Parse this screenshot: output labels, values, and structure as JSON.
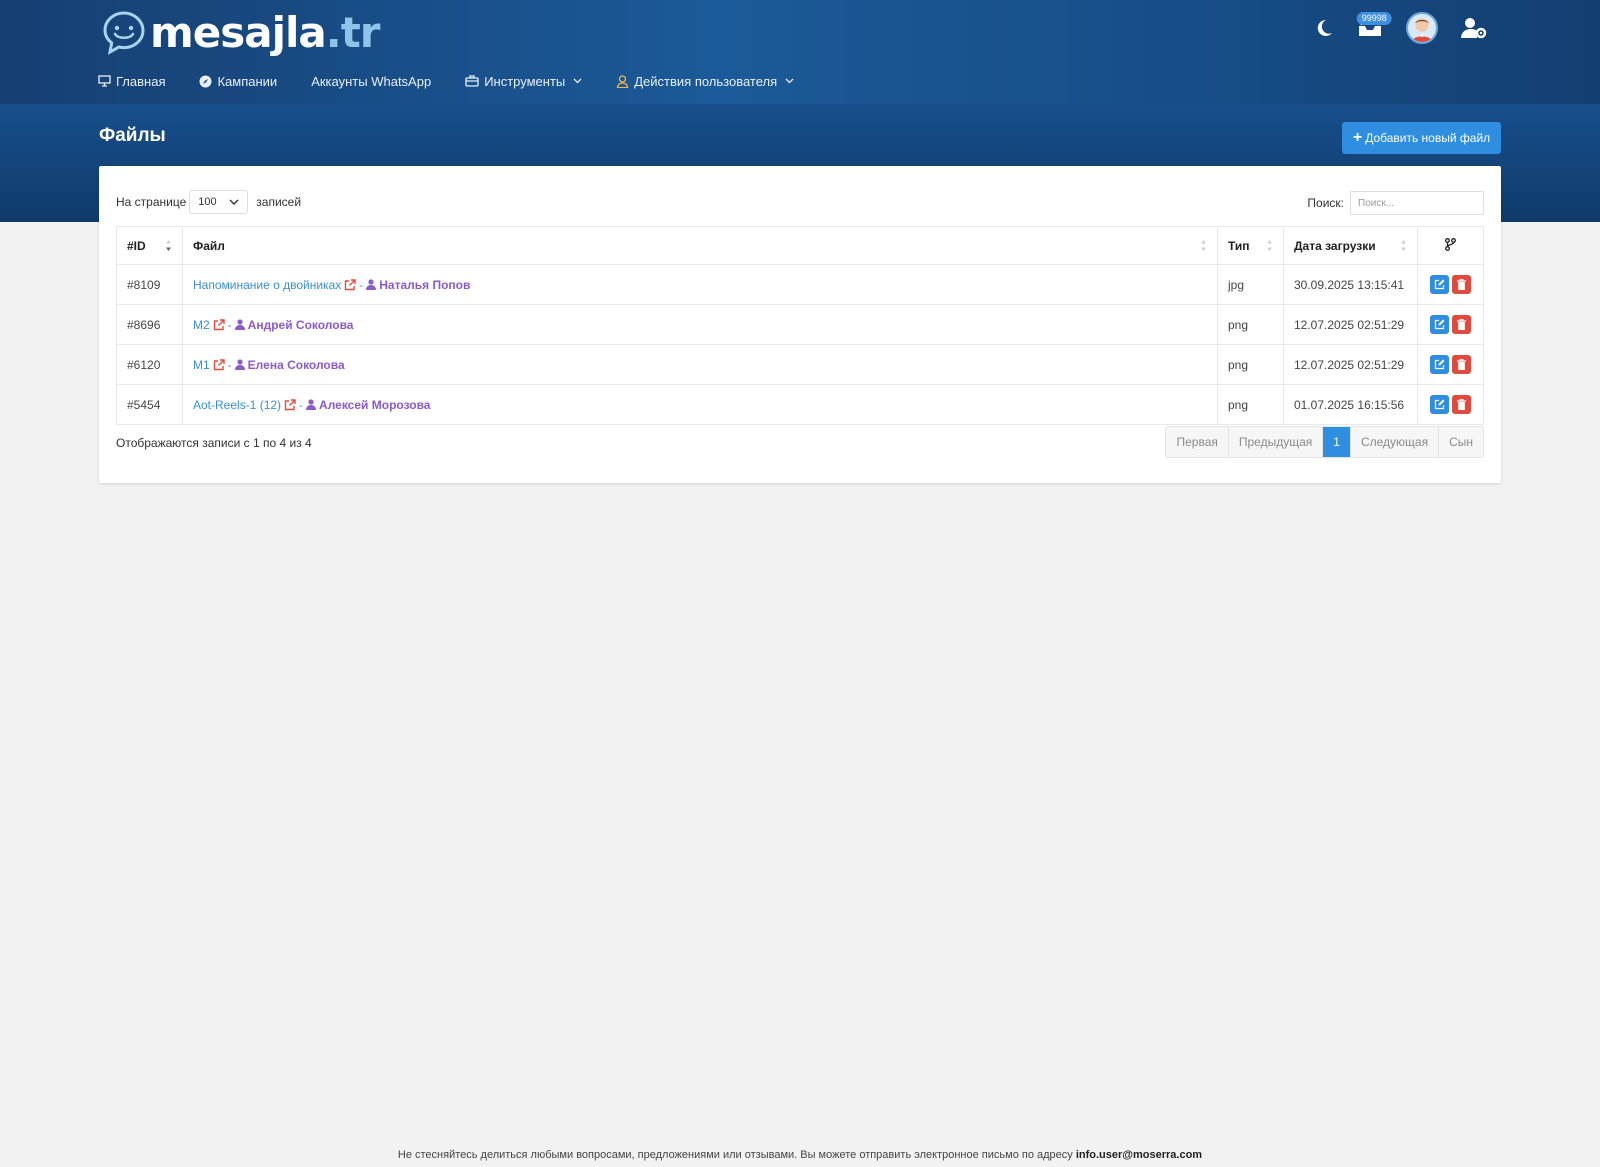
{
  "brand": {
    "name": "mesajla",
    "tld": ".tr"
  },
  "topbar": {
    "notification_count": "99998"
  },
  "nav": [
    {
      "label": "Главная",
      "icon": "monitor-icon"
    },
    {
      "label": "Кампании",
      "icon": "compass-icon"
    },
    {
      "label": "Аккаунты WhatsApp",
      "icon": ""
    },
    {
      "label": "Инструменты",
      "icon": "toolbox-icon"
    },
    {
      "label": "Действия пользователя",
      "icon": "user-icon"
    }
  ],
  "page": {
    "title": "Файлы",
    "add_button": "Добавить новый файл"
  },
  "controls": {
    "per_page_label": "На странице",
    "per_page_value": "100",
    "records_label": "записей",
    "search_label": "Поиск:",
    "search_placeholder": "Поиск..."
  },
  "table": {
    "headers": {
      "id": "#ID",
      "file": "Файл",
      "type": "Тип",
      "date": "Дата загрузки"
    },
    "rows": [
      {
        "id": "#8109",
        "file": "Напоминание о двойниках",
        "user": "Наталья Попов",
        "type": "jpg",
        "date": "30.09.2025 13:15:41"
      },
      {
        "id": "#8696",
        "file": "M2",
        "user": "Андрей Соколова",
        "type": "png",
        "date": "12.07.2025 02:51:29"
      },
      {
        "id": "#6120",
        "file": "M1",
        "user": "Елена Соколова",
        "type": "png",
        "date": "12.07.2025 02:51:29"
      },
      {
        "id": "#5454",
        "file": "Aot-Reels-1 (12)",
        "user": "Алексей Морозова",
        "type": "png",
        "date": "01.07.2025 16:15:56"
      }
    ]
  },
  "footer_info": "Отображаются записи с 1 по 4 из 4",
  "pagination": {
    "first": "Первая",
    "prev": "Предыдущая",
    "current": "1",
    "next": "Следующая",
    "last": "Сын"
  },
  "footer": {
    "text": "Не стесняйтесь делиться любыми вопросами, предложениями или отзывами. Вы можете отправить электронное письмо по адресу",
    "email": "info.user@moserra.com"
  },
  "colors": {
    "accent": "#2f8ee0",
    "danger": "#e04b3e",
    "user": "#8b5bc9",
    "link": "#3a8fd4"
  }
}
